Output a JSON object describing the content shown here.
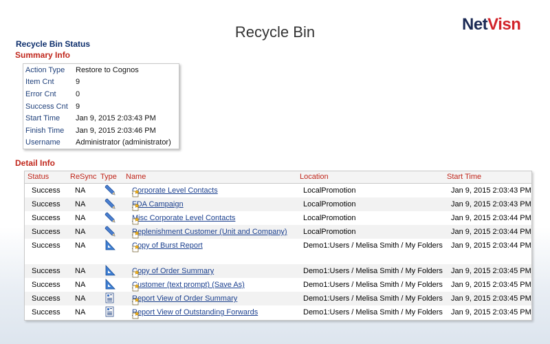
{
  "page": {
    "title": "Recycle Bin"
  },
  "logo": {
    "part1": "Net",
    "part2": "Visn"
  },
  "status_title": "Recycle Bin Status",
  "summary": {
    "title": "Summary Info",
    "rows": [
      {
        "label": "Action Type",
        "value": "Restore to Cognos"
      },
      {
        "label": "Item Cnt",
        "value": "9"
      },
      {
        "label": "Error Cnt",
        "value": "0"
      },
      {
        "label": "Success Cnt",
        "value": "9"
      },
      {
        "label": "Start Time",
        "value": "Jan 9, 2015 2:03:43 PM"
      },
      {
        "label": "Finish Time",
        "value": "Jan 9, 2015 2:03:46 PM"
      },
      {
        "label": "Username",
        "value": "Administrator (administrator)"
      }
    ]
  },
  "detail": {
    "title": "Detail Info",
    "columns": {
      "status": "Status",
      "resync": "ReSync",
      "type": "Type",
      "name": "Name",
      "location": "Location",
      "start": "Start Time"
    },
    "rows": [
      {
        "status": "Success",
        "resync": "NA",
        "type_icon": "pencil-icon",
        "name": "Corporate Level Contacts",
        "location": "LocalPromotion",
        "start": "Jan 9, 2015 2:03:43 PM"
      },
      {
        "status": "Success",
        "resync": "NA",
        "type_icon": "pencil-icon",
        "name": "FDA Campaign",
        "location": "LocalPromotion",
        "start": "Jan 9, 2015 2:03:43 PM"
      },
      {
        "status": "Success",
        "resync": "NA",
        "type_icon": "pencil-icon",
        "name": "Misc Corporate Level Contacts",
        "location": "LocalPromotion",
        "start": "Jan 9, 2015 2:03:44 PM"
      },
      {
        "status": "Success",
        "resync": "NA",
        "type_icon": "pencil-icon",
        "name": "Replenishment Customer (Unit and Company)",
        "location": "LocalPromotion",
        "start": "Jan 9, 2015 2:03:44 PM"
      },
      {
        "status": "Success",
        "resync": "NA",
        "type_icon": "triangle-ruler-icon",
        "name": "Copy of Burst Report",
        "location": "Demo1:Users / Melisa Smith / My Folders",
        "start": "Jan 9, 2015 2:03:44 PM"
      },
      {
        "status": "Success",
        "resync": "NA",
        "type_icon": "triangle-ruler-icon",
        "name": "Copy of Order Summary",
        "location": "Demo1:Users / Melisa Smith / My Folders",
        "start": "Jan 9, 2015 2:03:45 PM"
      },
      {
        "status": "Success",
        "resync": "NA",
        "type_icon": "triangle-ruler-icon",
        "name": "Customer (text prompt) (Save As)",
        "location": "Demo1:Users / Melisa Smith / My Folders",
        "start": "Jan 9, 2015 2:03:45 PM"
      },
      {
        "status": "Success",
        "resync": "NA",
        "type_icon": "report-view-icon",
        "name": "Report View of Order Summary",
        "location": "Demo1:Users / Melisa Smith / My Folders",
        "start": "Jan 9, 2015 2:03:45 PM"
      },
      {
        "status": "Success",
        "resync": "NA",
        "type_icon": "report-view-icon",
        "name": "Report View of Outstanding Forwards",
        "location": "Demo1:Users / Melisa Smith / My Folders",
        "start": "Jan 9, 2015 2:03:45 PM"
      }
    ]
  }
}
